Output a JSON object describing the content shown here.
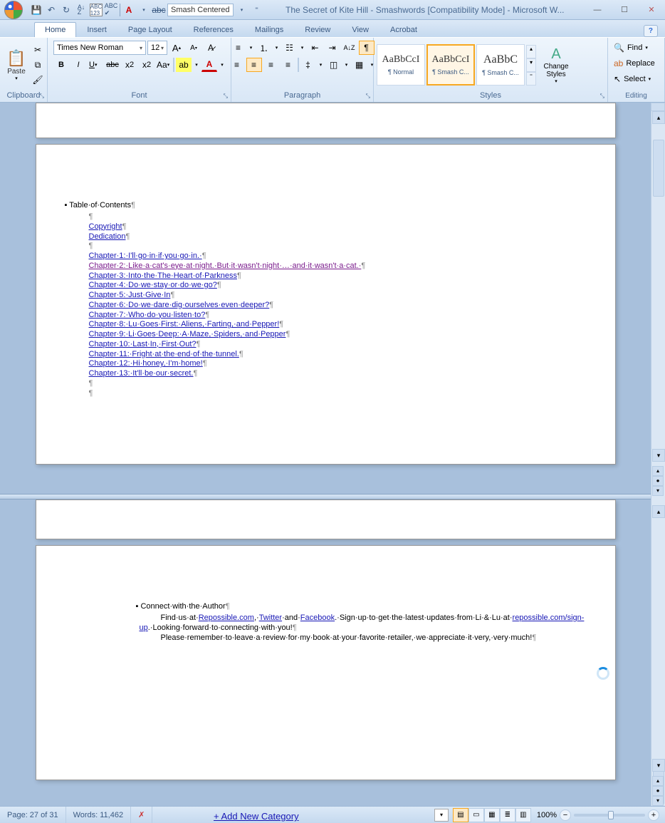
{
  "title": "The Secret of Kite Hill - Smashwords [Compatibility Mode] - Microsoft W...",
  "qat_style_box": "Smash Centered",
  "tabs": [
    "Home",
    "Insert",
    "Page Layout",
    "References",
    "Mailings",
    "Review",
    "View",
    "Acrobat"
  ],
  "ribbon": {
    "clipboard": {
      "label": "Clipboard",
      "paste": "Paste"
    },
    "font": {
      "label": "Font",
      "name": "Times New Roman",
      "size": "12"
    },
    "paragraph": {
      "label": "Paragraph"
    },
    "styles": {
      "label": "Styles",
      "items": [
        {
          "preview": "AaBbCcI",
          "name": "¶ Normal"
        },
        {
          "preview": "AaBbCcI",
          "name": "¶ Smash C..."
        },
        {
          "preview": "AaBbC",
          "name": "¶ Smash C..."
        }
      ],
      "change": "Change Styles"
    },
    "editing": {
      "label": "Editing",
      "find": "Find",
      "replace": "Replace",
      "select": "Select"
    }
  },
  "doc": {
    "toc_heading": "Table·of·Contents",
    "toc_links": [
      "Copyright",
      "Dedication",
      "",
      "Chapter·1:·I'll·go·in·if·you·go·in.·",
      "Chapter·2:·Like·a·cat's·eye·at·night.·But·it·wasn't·night·…·and·it·wasn't·a·cat.·",
      "Chapter·3:·Into·the·The·Heart·of·Parkness",
      "Chapter·4:·Do·we·stay·or·do·we·go?",
      "Chapter·5:·Just·Give·In",
      "Chapter·6:·Do·we·dare·dig·ourselves·even·deeper?",
      "Chapter·7:·Who·do·you·listen·to?",
      "Chapter·8:·Lu·Goes·First:·Aliens,·Farting,·and·Pepper!",
      "Chapter·9:·Li·Goes·Deep:·A·Maze,·Spiders,·and·Pepper",
      "Chapter·10:·Last·In,·First·Out?",
      "Chapter·11:·Fright·at·the·end·of·the·tunnel.",
      "Chapter·12:·Hi·honey,·I'm·home!",
      "Chapter·13:·It'll·be·our·secret."
    ],
    "connect_heading": "Connect·with·the·Author",
    "connect_p1_a": "Find·us·at·",
    "connect_link1": "Repossible.com",
    "connect_p1_b": ",·",
    "connect_link2": "Twitter",
    "connect_p1_c": "·and·",
    "connect_link3": "Facebook",
    "connect_p1_d": ".·Sign·up·to·get·the·latest·updates·from·Li·&·Lu·at·",
    "connect_link4": "repossible.com/sign-up",
    "connect_p1_e": ".·Looking·forward·to·connecting·with·you!",
    "connect_p2": "Please·remember·to·leave·a·review·for·my·book·at·your·favorite·retailer,·we·appreciate·it·very,·very·much!"
  },
  "status": {
    "page": "Page: 27 of 31",
    "words": "Words: 11,462",
    "zoom": "100%"
  },
  "footer": {
    "add_category": "+ Add New Category"
  }
}
